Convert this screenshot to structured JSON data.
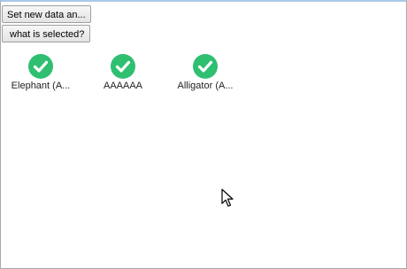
{
  "buttons": {
    "set_new_data": "Set new data an...",
    "what_selected": "what is selected?"
  },
  "items": [
    {
      "label": "Elephant (A...",
      "icon": "check-circle-icon"
    },
    {
      "label": "AAAAAA",
      "icon": "check-circle-icon"
    },
    {
      "label": "Alligator (A...",
      "icon": "check-circle-icon"
    }
  ],
  "colors": {
    "check_green": "#2fbf71",
    "window_top_border": "#a9c8ea"
  }
}
